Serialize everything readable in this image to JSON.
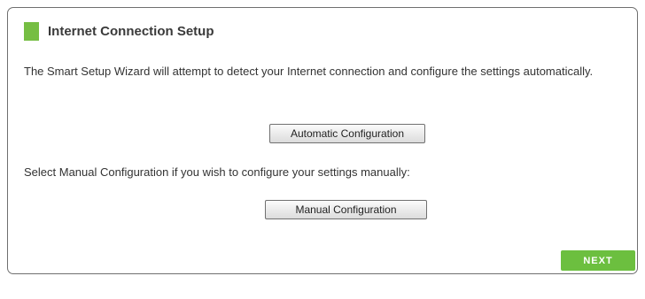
{
  "setup": {
    "title": "Internet Connection Setup",
    "intro_text": "The Smart Setup Wizard will attempt to detect your Internet connection and configure the settings automatically.",
    "auto_button_label": "Automatic Configuration",
    "manual_text": "Select Manual Configuration if you wish to configure your settings manually:",
    "manual_button_label": "Manual Configuration",
    "next_button_label": "NEXT"
  },
  "colors": {
    "accent_green": "#76be43",
    "next_button_bg": "#6cbf3f",
    "panel_border": "#6f6f6f"
  }
}
